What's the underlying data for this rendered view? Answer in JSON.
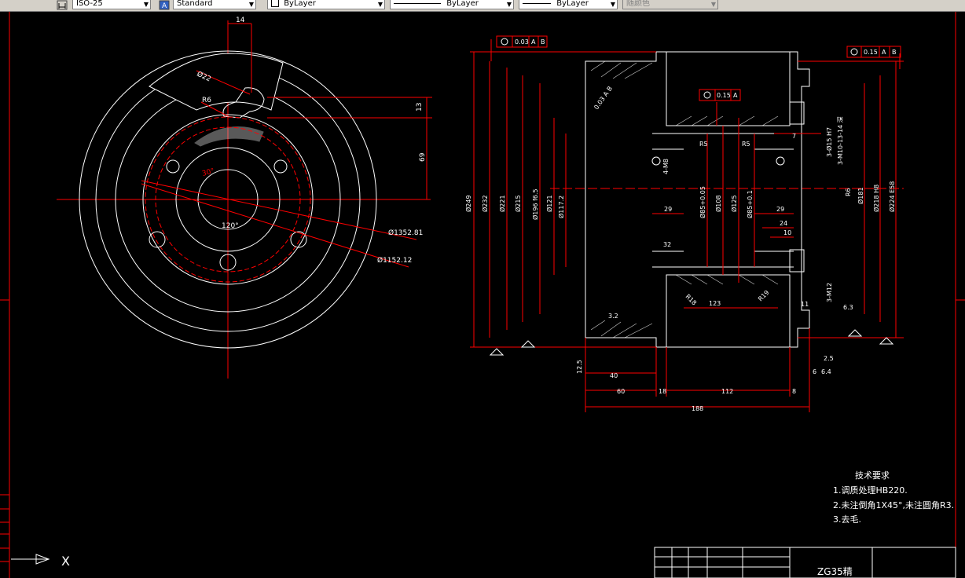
{
  "toolbar": {
    "dimstyle_value": "ISO-25",
    "textstyle_value": "Standard",
    "layer_value": "ByLayer",
    "linetype_value": "ByLayer",
    "lineweight_value": "ByLayer",
    "plotstyle_value": "随颜色"
  },
  "colors": {
    "background": "#000000",
    "geometry": "#ffffff",
    "dimension": "#ff0000",
    "toolbar": "#d4d0c8"
  },
  "ucs": {
    "x_label": "X"
  },
  "front_view": {
    "dim_14": "14",
    "dim_r22": "Ø22",
    "dim_r6": "R6",
    "dim_13": "13",
    "dim_69": "69",
    "angle_30": "30°",
    "angle_120": "120°",
    "dia_1352": "Ø1352.81",
    "dia_1152": "Ø1152.12"
  },
  "section_view": {
    "tol_top_left": {
      "value": "0.03",
      "datum1": "A",
      "datum2": "B"
    },
    "tol_top_right": {
      "value": "0.15",
      "datum1": "A",
      "datum2": "B"
    },
    "tol_mid": {
      "value": "0.15",
      "datum1": "A"
    },
    "tol_slant": "0.03 A B",
    "left_dims": [
      "Ø249",
      "Ø232",
      "Ø221",
      "Ø215",
      "Ø196 f6.5",
      "Ø121",
      "Ø117.2"
    ],
    "bore_dims": [
      "Ø85+0.05",
      "Ø108",
      "Ø125",
      "Ø85+0.1"
    ],
    "right_dims": [
      "R6",
      "Ø181",
      "Ø218 H8",
      "Ø224 E58"
    ],
    "thread_top": "3-Ø15 H7",
    "thread_top2": "3-M10-13-14 深",
    "thread_left": "4-M8",
    "thread_right": "3-M12",
    "r5_left": "R5",
    "r5_right": "R5",
    "r18": "R18",
    "r19": "R19",
    "dim_29_left": "29",
    "dim_29_right": "29",
    "dim_24": "24",
    "dim_10": "10",
    "dim_7": "7",
    "dim_32": "32",
    "dim_123": "123",
    "dim_11": "11",
    "rough_6_3": "6.3",
    "rough_12_5": "12.5",
    "rough_3_2": "3.2",
    "dim_40": "40",
    "dim_60": "60",
    "dim_18": "18",
    "dim_112": "112",
    "dim_8": "8",
    "dim_188": "188",
    "dim_2_5": "2.5",
    "dim_6": "6",
    "dim_6_4": "6.4"
  },
  "notes": {
    "title": "技术要求",
    "line1": "1.调质处理HB220.",
    "line2": "2.未注倒角1X45°,未注圆角R3.",
    "line3": "3.去毛."
  },
  "title_block": {
    "material": "ZG35精"
  }
}
